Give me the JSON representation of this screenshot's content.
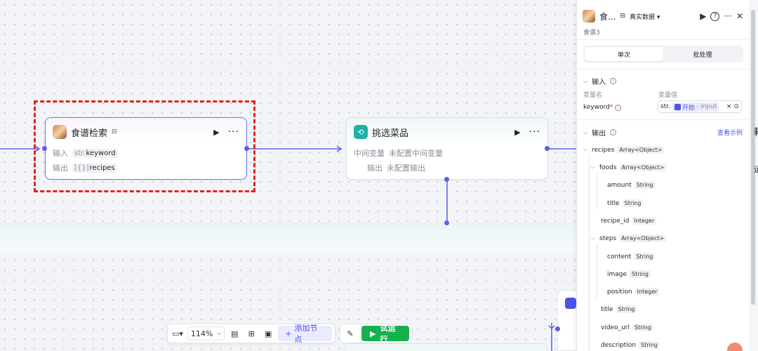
{
  "nodes": {
    "recipe_search": {
      "title": "食谱检索",
      "input_label": "输入",
      "input_type": "str.",
      "input_name": "keyword",
      "output_label": "输出",
      "output_type": "[{}]",
      "output_name": "recipes"
    },
    "pick_dishes": {
      "title": "挑选菜品",
      "mid_label": "中间变量",
      "mid_value": "未配置中间变量",
      "output_label": "输出",
      "output_value": "未配置输出"
    }
  },
  "toolbar": {
    "zoom": "114%",
    "add_node": "添加节点",
    "run": "试运行"
  },
  "panel": {
    "title": "食...",
    "data_mode": "真实数据",
    "subtitle": "食谱3",
    "tabs": [
      "单次",
      "批处理"
    ],
    "input_section": "输入",
    "col_var_name": "变量名",
    "col_var_value": "变量值",
    "var_name": "keyword",
    "ref_type": "str.",
    "ref_source": "开始",
    "ref_field": "- input",
    "output_section": "输出",
    "view_example": "查看示例",
    "tree": [
      {
        "name": "recipes",
        "type": "Array<Object>"
      },
      {
        "name": "foods",
        "type": "Array<Object>"
      },
      {
        "name": "amount",
        "type": "String"
      },
      {
        "name": "title",
        "type": "String"
      },
      {
        "name": "recipe_id",
        "type": "Integer"
      },
      {
        "name": "steps",
        "type": "Array<Object>"
      },
      {
        "name": "content",
        "type": "String"
      },
      {
        "name": "image",
        "type": "String"
      },
      {
        "name": "position",
        "type": "Integer"
      },
      {
        "name": "title",
        "type": "String"
      },
      {
        "name": "video_url",
        "type": "String"
      },
      {
        "name": "description",
        "type": "String"
      }
    ]
  },
  "cutoff": {
    "glyph1": "耗",
    "glyph2": "运"
  },
  "colors": {
    "accent": "#4d53e8",
    "run": "#15b14f",
    "selection": "#e8211c",
    "teal": "#1fb0a8"
  },
  "icons": [
    "play-icon",
    "more-icon",
    "loop-icon",
    "help-icon",
    "close-icon",
    "info-icon",
    "map-icon",
    "grid-icon",
    "comment-icon",
    "tool-icon"
  ]
}
